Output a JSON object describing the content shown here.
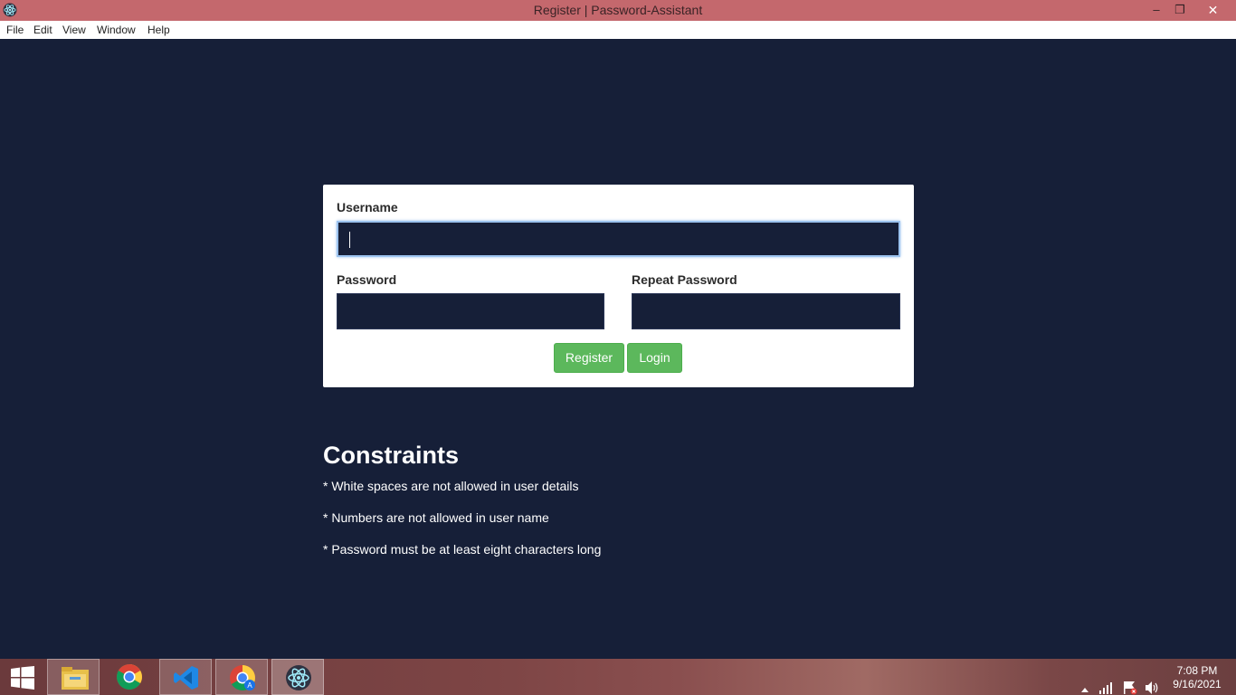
{
  "window": {
    "title": "Register | Password-Assistant",
    "minimize_glyph": "–",
    "restore_glyph": "❐",
    "close_glyph": "✕"
  },
  "menu": [
    "File",
    "Edit",
    "View",
    "Window",
    "Help"
  ],
  "form": {
    "username_label": "Username",
    "username_value": "",
    "password_label": "Password",
    "password_value": "",
    "repeat_password_label": "Repeat Password",
    "repeat_password_value": "",
    "register_button": "Register",
    "login_button": "Login"
  },
  "constraints": {
    "title": "Constraints",
    "items": [
      "* White spaces are not allowed in user details",
      "* Numbers are not allowed in user name",
      "* Password must be at least eight characters long"
    ]
  },
  "taskbar": {
    "items": [
      "start-icon",
      "file-explorer-icon",
      "chrome-icon",
      "vscode-icon",
      "chrome-profile-icon",
      "electron-icon"
    ],
    "active_item": "electron-icon",
    "time": "7:08 PM",
    "date": "9/16/2021"
  },
  "colors": {
    "background": "#161f38",
    "titlebar": "#c4686d",
    "button_green": "#5cb85c"
  }
}
